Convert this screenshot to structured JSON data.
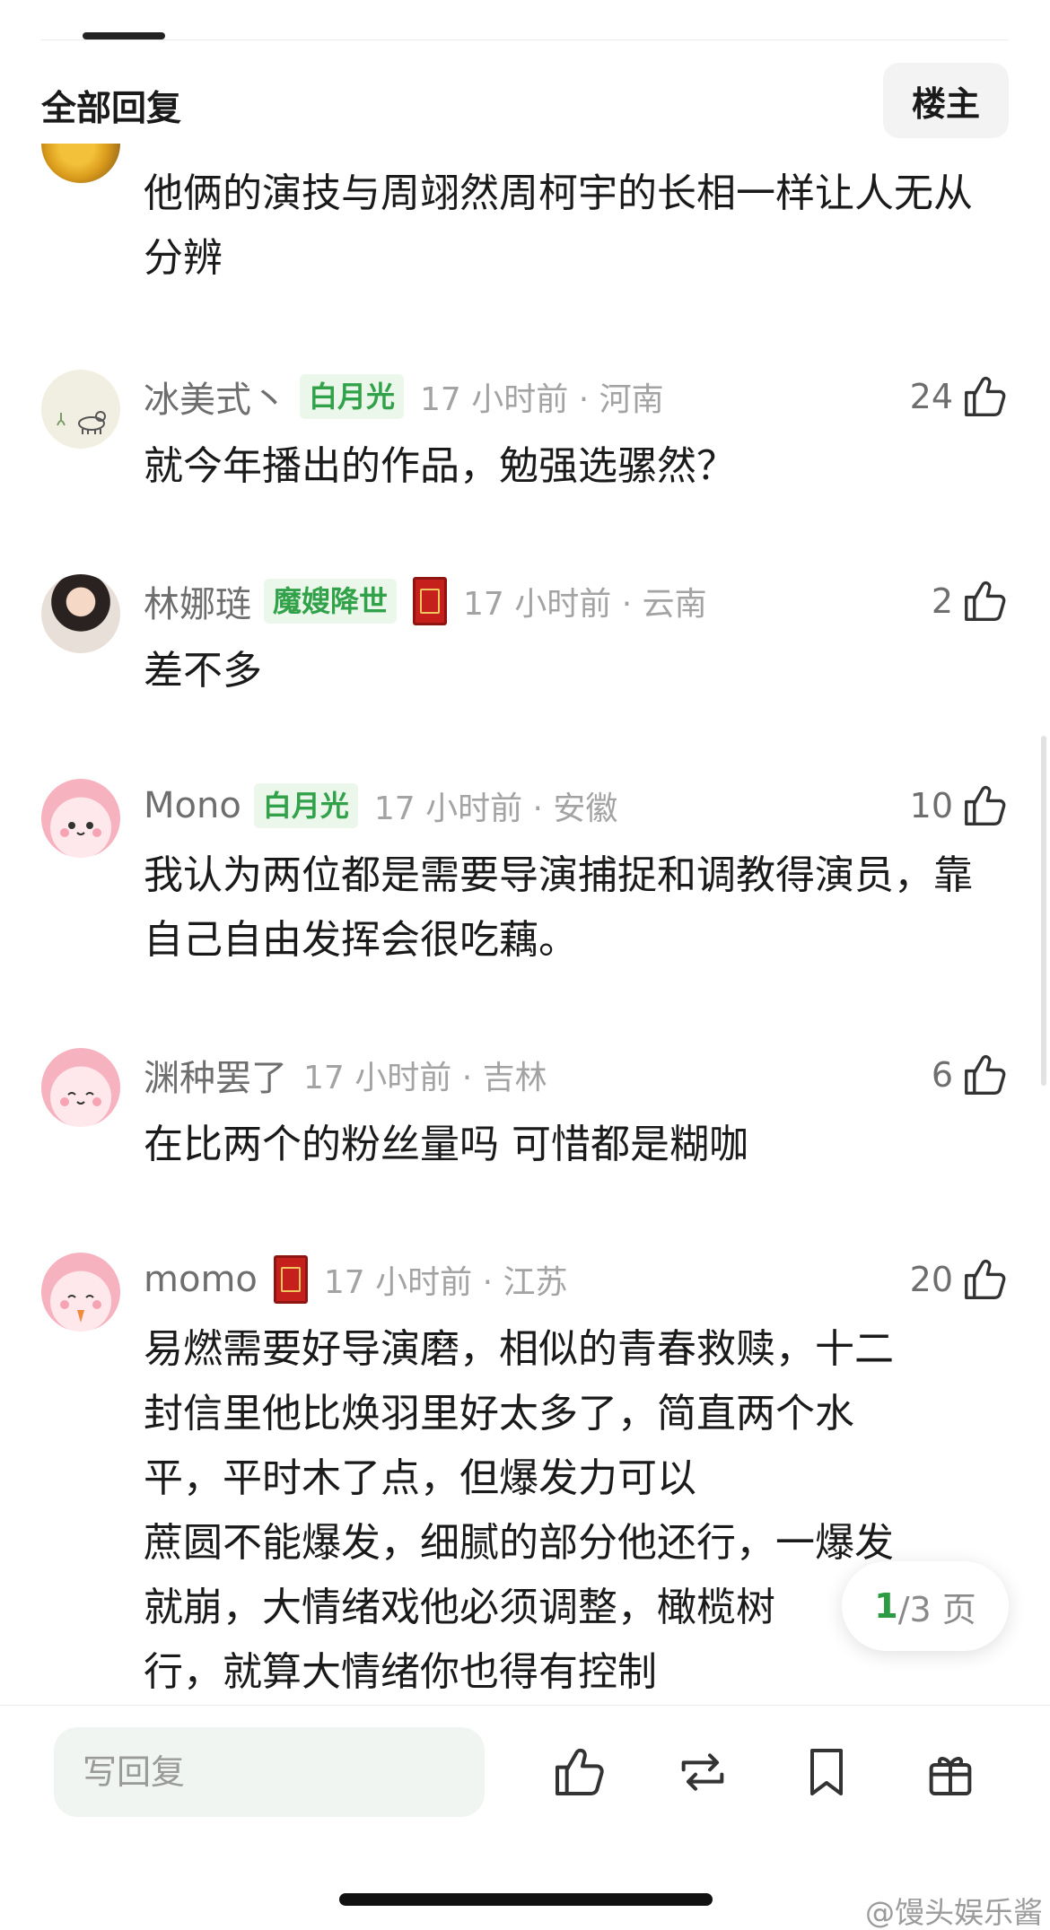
{
  "header": {
    "title": "全部回复",
    "op_button": "楼主"
  },
  "partial_comment": {
    "text": "他俩的演技与周翊然周柯宇的长相一样让人无从分辨"
  },
  "comments": [
    {
      "username": "冰美式丶",
      "badge": "白月光",
      "has_medal": false,
      "time_location": "17 小时前 · 河南",
      "likes": "24",
      "text": "就今年播出的作品，勉强选骡然？"
    },
    {
      "username": "林娜琏",
      "badge": "魔嫂降世",
      "has_medal": true,
      "time_location": "17 小时前 · 云南",
      "likes": "2",
      "text": "差不多"
    },
    {
      "username": "Mono",
      "badge": "白月光",
      "has_medal": false,
      "time_location": "17 小时前 · 安徽",
      "likes": "10",
      "text": "我认为两位都是需要导演捕捉和调教得演员，靠自己自由发挥会很吃藕。"
    },
    {
      "username": "渊种罢了",
      "badge": "",
      "has_medal": false,
      "time_location": "17 小时前 · 吉林",
      "likes": "6",
      "text": "在比两个的粉丝量吗 可惜都是糊咖"
    },
    {
      "username": "momo",
      "badge": "",
      "has_medal": true,
      "time_location": "17 小时前 · 江苏",
      "likes": "20",
      "text_lines": [
        "易燃需要好导演磨，相似的青春救赎，十二",
        "封信里他比焕羽里好太多了，简直两个水",
        "平，平时木了点，但爆发力可以",
        "蔗圆不能爆发，细腻的部分他还行，一爆发",
        "就崩，大情绪戏他必须调整，橄榄树",
        "行，就算大情绪你也得有控制"
      ]
    }
  ],
  "pagination": {
    "current": "1",
    "rest": "/3 页"
  },
  "bottom_bar": {
    "reply_placeholder": "写回复",
    "icons": [
      "like-icon",
      "repost-icon",
      "bookmark-icon",
      "gift-icon"
    ]
  },
  "watermark": "@馒头娱乐酱",
  "colors": {
    "accent_green": "#32a24a",
    "badge_bg": "#eaf7ea",
    "meta_gray": "#a3a3a3",
    "username_gray": "#6e6e6e",
    "medal_red": "#c6201c"
  }
}
